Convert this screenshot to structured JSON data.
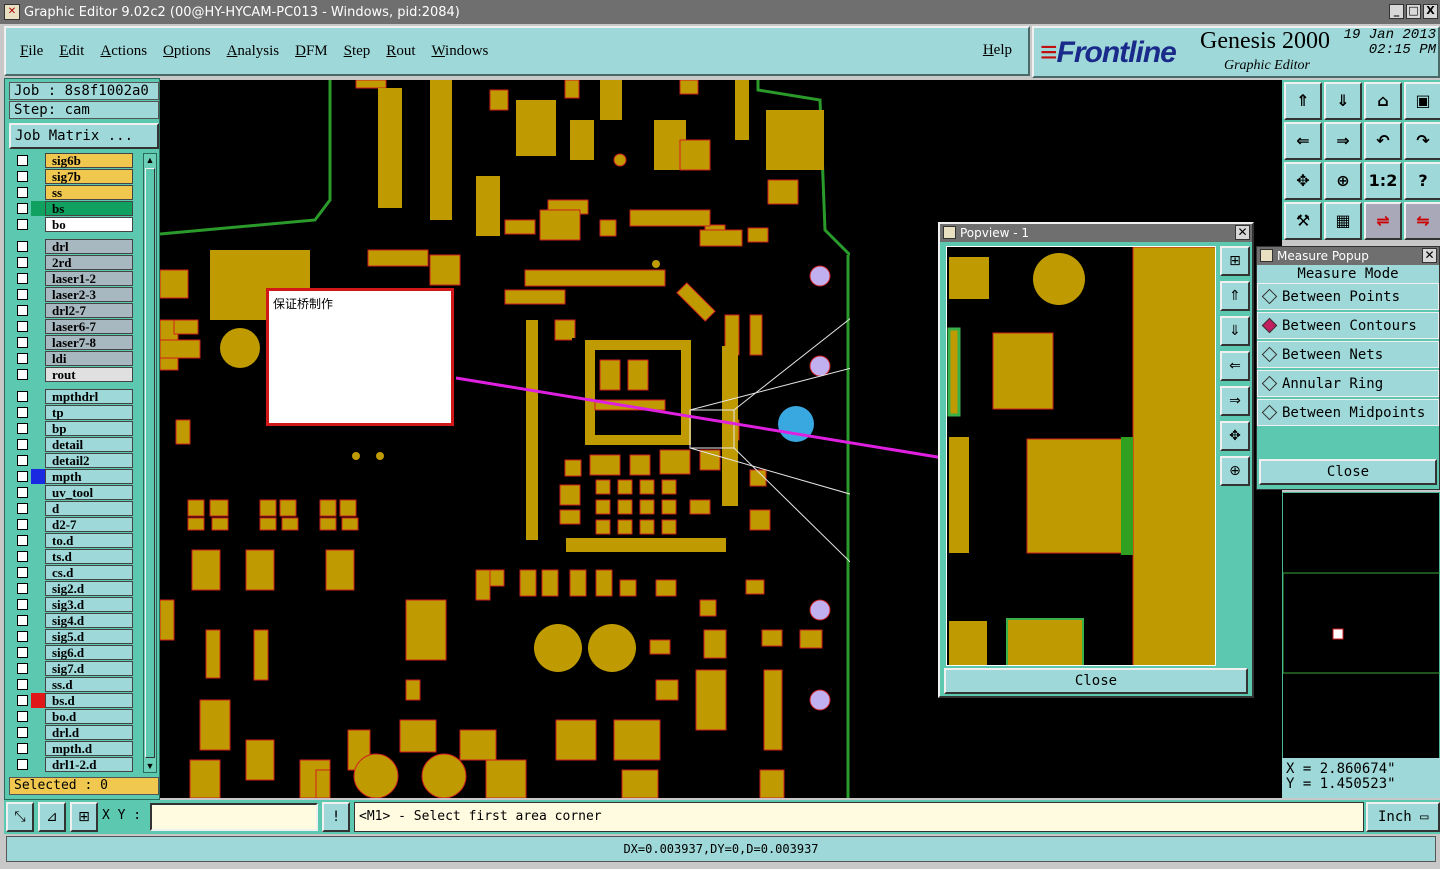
{
  "window": {
    "title": "Graphic Editor 9.02c2 (00@HY-HYCAM-PC013 - Windows, pid:2084)",
    "buttons": [
      "_",
      "□",
      "X"
    ]
  },
  "menu": {
    "items": [
      "File",
      "Edit",
      "Actions",
      "Options",
      "Analysis",
      "DFM",
      "Step",
      "Rout",
      "Windows"
    ],
    "help": "Help"
  },
  "brand": {
    "logo": "Frontline",
    "product": "Genesis 2000",
    "subtitle": "Graphic Editor",
    "date": "19 Jan 2013",
    "time": "02:15 PM"
  },
  "left": {
    "job": "Job : 8s8f1002a0",
    "step": "Step: cam",
    "job_matrix": "Job Matrix ...",
    "selected": "Selected : 0",
    "layers": [
      {
        "name": "sig6b",
        "bg": "#f0c850",
        "swatch": ""
      },
      {
        "name": "sig7b",
        "bg": "#f0c850",
        "swatch": ""
      },
      {
        "name": "ss",
        "bg": "#f0c850",
        "swatch": ""
      },
      {
        "name": "bs",
        "bg": "#10a060",
        "swatch": "#10a060"
      },
      {
        "name": "bo",
        "bg": "#ffffff",
        "swatch": ""
      },
      {
        "gap": true
      },
      {
        "name": "drl",
        "bg": "#a8b8c0",
        "swatch": ""
      },
      {
        "name": "2rd",
        "bg": "#a8b8c0",
        "swatch": ""
      },
      {
        "name": "laser1-2",
        "bg": "#a8b8c0",
        "swatch": ""
      },
      {
        "name": "laser2-3",
        "bg": "#a8b8c0",
        "swatch": ""
      },
      {
        "name": "drl2-7",
        "bg": "#a8b8c0",
        "swatch": ""
      },
      {
        "name": "laser6-7",
        "bg": "#a8b8c0",
        "swatch": ""
      },
      {
        "name": "laser7-8",
        "bg": "#a8b8c0",
        "swatch": ""
      },
      {
        "name": "ldi",
        "bg": "#a8b8c0",
        "swatch": ""
      },
      {
        "name": "rout",
        "bg": "#e0e0e0",
        "swatch": ""
      },
      {
        "gap": true
      },
      {
        "name": "mpthdrl",
        "bg": "#9fd8d8",
        "swatch": ""
      },
      {
        "name": "tp",
        "bg": "#9fd8d8",
        "swatch": ""
      },
      {
        "name": "bp",
        "bg": "#9fd8d8",
        "swatch": ""
      },
      {
        "name": "detail",
        "bg": "#9fd8d8",
        "swatch": ""
      },
      {
        "name": "detail2",
        "bg": "#9fd8d8",
        "swatch": ""
      },
      {
        "name": "mpth",
        "bg": "#9fd8d8",
        "swatch": "#1a2ae0"
      },
      {
        "name": "uv_tool",
        "bg": "#9fd8d8",
        "swatch": ""
      },
      {
        "name": "d",
        "bg": "#9fd8d8",
        "swatch": ""
      },
      {
        "name": "d2-7",
        "bg": "#9fd8d8",
        "swatch": ""
      },
      {
        "name": "to.d",
        "bg": "#9fd8d8",
        "swatch": ""
      },
      {
        "name": "ts.d",
        "bg": "#9fd8d8",
        "swatch": ""
      },
      {
        "name": "cs.d",
        "bg": "#9fd8d8",
        "swatch": ""
      },
      {
        "name": "sig2.d",
        "bg": "#9fd8d8",
        "swatch": ""
      },
      {
        "name": "sig3.d",
        "bg": "#9fd8d8",
        "swatch": ""
      },
      {
        "name": "sig4.d",
        "bg": "#9fd8d8",
        "swatch": ""
      },
      {
        "name": "sig5.d",
        "bg": "#9fd8d8",
        "swatch": ""
      },
      {
        "name": "sig6.d",
        "bg": "#9fd8d8",
        "swatch": ""
      },
      {
        "name": "sig7.d",
        "bg": "#9fd8d8",
        "swatch": ""
      },
      {
        "name": "ss.d",
        "bg": "#9fd8d8",
        "swatch": ""
      },
      {
        "name": "bs.d",
        "bg": "#9fd8d8",
        "swatch": "#e01818"
      },
      {
        "name": "bo.d",
        "bg": "#9fd8d8",
        "swatch": ""
      },
      {
        "name": "drl.d",
        "bg": "#9fd8d8",
        "swatch": ""
      },
      {
        "name": "mpth.d",
        "bg": "#9fd8d8",
        "swatch": ""
      },
      {
        "name": "drl1-2.d",
        "bg": "#9fd8d8",
        "swatch": ""
      }
    ]
  },
  "note": {
    "text": "保证桥制作"
  },
  "popview": {
    "title": "Popview - 1",
    "close": "Close"
  },
  "measure": {
    "title": "Measure Popup",
    "mode_label": "Measure Mode",
    "options": [
      {
        "label": "Between Points",
        "selected": false
      },
      {
        "label": "Between Contours",
        "selected": true
      },
      {
        "label": "Between Nets",
        "selected": false
      },
      {
        "label": "Annular Ring",
        "selected": false
      },
      {
        "label": "Between Midpoints",
        "selected": false
      }
    ],
    "close": "Close"
  },
  "toolgrid": {
    "icons": [
      "up-arrow-icon",
      "down-arrow-icon",
      "home-icon",
      "window-icon",
      "left-arrow-icon",
      "right-arrow-icon",
      "undo-view-icon",
      "redo-view-icon",
      "fit-icon",
      "zoom-center-icon",
      "scale-1-2-icon",
      "help-icon",
      "tools-icon",
      "grid-icon",
      "net-icon",
      "net2-icon"
    ],
    "labels": [
      "⇑",
      "⇓",
      "⌂",
      "▣",
      "⇐",
      "⇒",
      "↶",
      "↷",
      "✥",
      "⊕",
      "1:2",
      "?",
      "⚒",
      "▦",
      "⇌",
      "⇋"
    ]
  },
  "coords": {
    "x": "X = 2.860674\"",
    "y": "Y = 1.450523\""
  },
  "cmd": {
    "xy_label": "X Y :",
    "xy_value": "",
    "prompt": "<M1> - Select first area corner",
    "unit": "Inch"
  },
  "status": {
    "text": "DX=0.003937,DY=0,D=0.003937"
  },
  "colors": {
    "copper": "#bf9a00",
    "copper_alt": "#c8a000",
    "outline": "#e02020",
    "highlight": "#d030d0",
    "panel": "#9fd8d8",
    "panel_dark": "#5cc8b0"
  }
}
